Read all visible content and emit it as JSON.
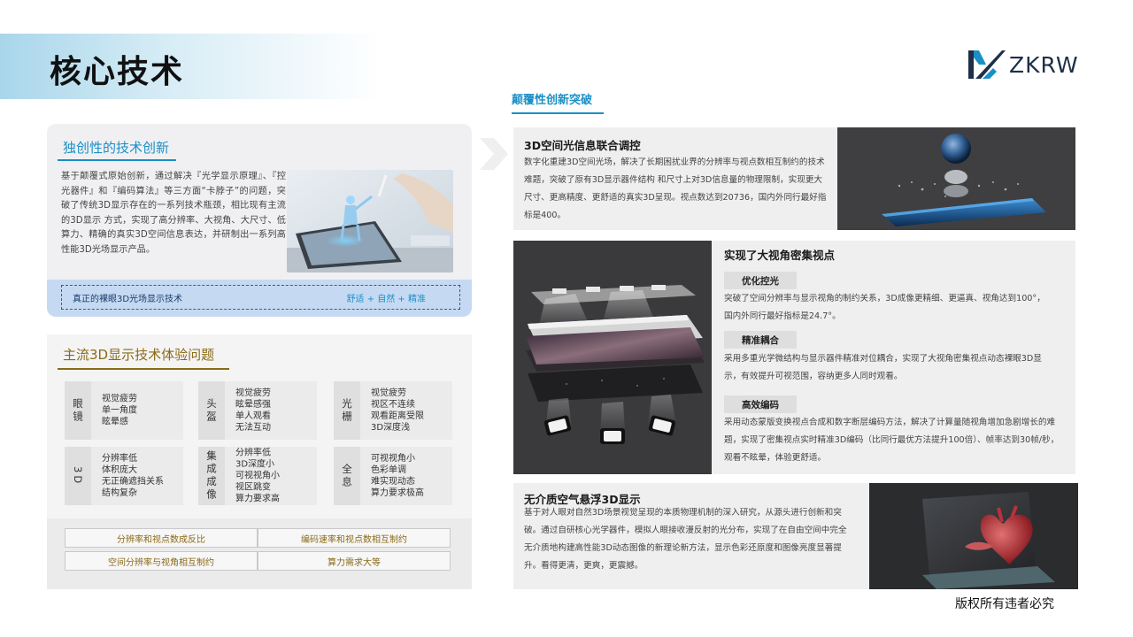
{
  "page": {
    "title": "核心技术",
    "right_heading": "颠覆性创新突破",
    "copyright": "版权所有违者必究"
  },
  "logo": {
    "text": "ZKRW"
  },
  "panel_innovation": {
    "title": "独创性的技术创新",
    "body": "基于颠覆式原始创新，通过解决『光学显示原理』、『控光器件』和『编码算法』等三方面“卡脖子”的问题，突破了传统3D显示存在的一系列技术瓶颈，相比现有主流的3D显示 方式，实现了高分辨率、大视角、大尺寸、低算力、精确的真实3D空间信息表达，并研制出一系列高性能3D光场显示产品。",
    "tagline_left": "真正的裸眼3D光场显示技术",
    "tagline_right": "舒适 + 自然 + 精准"
  },
  "panel_problems": {
    "title": "主流3D显示技术体验问题",
    "cells": [
      {
        "key": "眼镜",
        "value": "视觉疲劳\n单一角度\n眩晕感"
      },
      {
        "key": "头盔",
        "value": "视觉疲劳\n眩晕感强\n单人观看\n无法互动"
      },
      {
        "key": "光栅",
        "value": "视觉疲劳\n视区不连续\n观看距离受限\n3D深度浅"
      },
      {
        "key": "3D",
        "value": "分辨率低\n体积庞大\n无正确遮挡关系\n结构复杂"
      },
      {
        "key": "集成成像",
        "value": "分辨率低\n3D深度小\n可视视角小\n视区跳变\n算力要求高"
      },
      {
        "key": "全息",
        "value": "可视视角小\n色彩单调\n难实现动态\n算力要求极高"
      }
    ],
    "issues": [
      "分辨率和视点数成反比",
      "编码速率和视点数相互制约",
      "空间分辨率与视角相互制约",
      "算力需求大等"
    ]
  },
  "card1": {
    "title": "3D空间光信息联合调控",
    "body": "数字化重建3D空间光场，解决了长期困扰业界的分辨率与视点数相互制约的技术难题，突破了原有3D显示器件结构 和尺寸上对3D信息量的物理限制，实现更大尺寸、更高精度、更舒适的真实3D呈现。视点数达到20736，国内外同行最好指标是400。"
  },
  "card2": {
    "title": "实现了大视角密集视点",
    "tag1": "优化控光",
    "body1": "突破了空间分辨率与显示视角的制约关系，3D成像更精细、更逼真、视角达到100°，国内外同行最好指标是24.7°。",
    "tag2": "精准耦合",
    "body2": "采用多重光学微结构与显示器件精准对位耦合，实现了大视角密集视点动态裸眼3D显示，有效提升可视范围，容纳更多人同时观看。",
    "tag3": "高效编码",
    "body3": "采用动态蒙版变换视点合成和数字断层编码方法，解决了计算量随视角增加急剧增长的难题，实现了密集视点实时精准3D编码（比同行最优方法提升100倍）、帧率达到30帧/秒，观看不眩晕，体验更舒适。"
  },
  "card3": {
    "title": "无介质空气悬浮3D显示",
    "body": "基于对人眼对自然3D场景视觉呈现的本质物理机制的深入研究，从源头进行创新和突破。通过自研核心光学器件，模拟人眼接收漫反射的光分布，实现了在自由空间中完全无介质地构建高性能3D动态图像的新理论新方法，显示色彩还原度和图像亮度显著提升。看得更清，更爽，更震撼。"
  },
  "colors": {
    "accent_blue": "#1a8fc6",
    "accent_gold": "#8a6a15",
    "tagline_band": "#c5daf2"
  }
}
